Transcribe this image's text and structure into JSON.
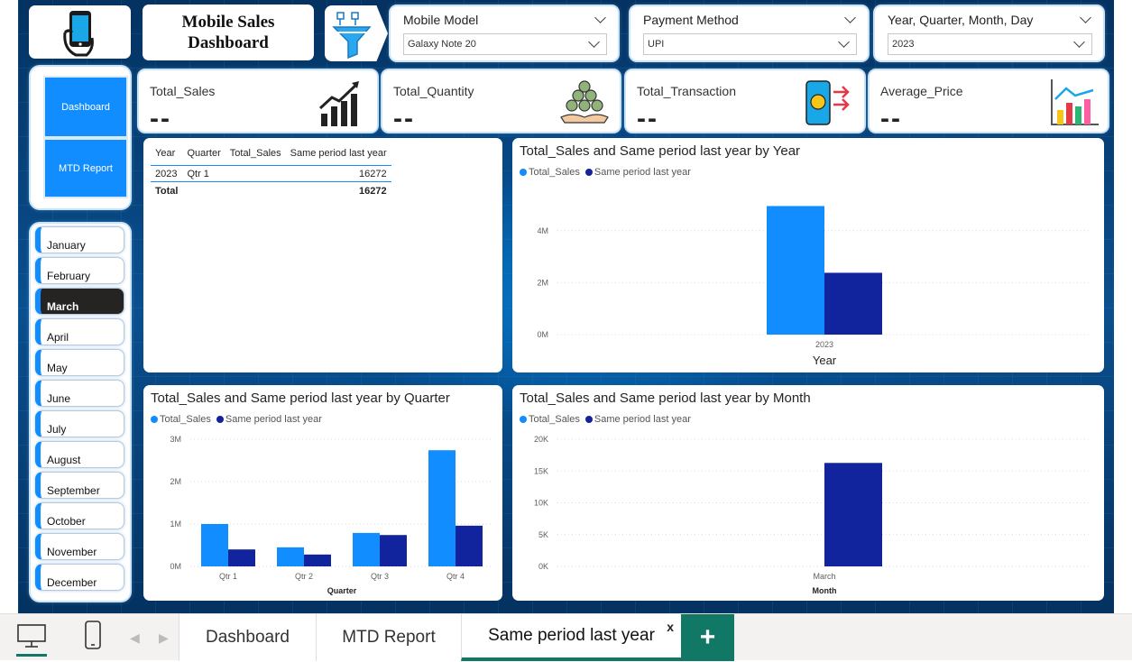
{
  "header": {
    "title_line1": "Mobile Sales",
    "title_line2": "Dashboard"
  },
  "slicers": {
    "mobile_model": {
      "label": "Mobile Model",
      "value": "Galaxy Note 20"
    },
    "payment_method": {
      "label": "Payment Method",
      "value": "UPI"
    },
    "date": {
      "label": "Year, Quarter, Month, Day",
      "value": "2023"
    }
  },
  "kpis": [
    {
      "label": "Total_Sales",
      "value": "--",
      "icon": "trend-chart-icon"
    },
    {
      "label": "Total_Quantity",
      "value": "--",
      "icon": "money-stack-icon"
    },
    {
      "label": "Total_Transaction",
      "value": "--",
      "icon": "phone-payment-icon"
    },
    {
      "label": "Average_Price",
      "value": "--",
      "icon": "bar-line-chart-icon"
    }
  ],
  "nav": {
    "dashboard": "Dashboard",
    "mtd_report": "MTD Report"
  },
  "months": [
    "January",
    "February",
    "March",
    "April",
    "May",
    "June",
    "July",
    "August",
    "September",
    "October",
    "November",
    "December"
  ],
  "active_month": "March",
  "matrix": {
    "headers": [
      "Year",
      "Quarter",
      "Total_Sales",
      "Same period last year"
    ],
    "row": {
      "year": "2023",
      "quarter": "Qtr 1",
      "total_sales": "",
      "same_period": "16272"
    },
    "total": {
      "label": "Total",
      "same_period": "16272"
    }
  },
  "legend": {
    "s1": "Total_Sales",
    "s2": "Same period last year"
  },
  "colors": {
    "total_sales": "#118dff",
    "same_period": "#12239e",
    "accent_green": "#117865"
  },
  "chart_data": [
    {
      "type": "bar",
      "title": "Total_Sales and Same period last year by Year",
      "xlabel": "Year",
      "ylabel": "",
      "categories": [
        "2023"
      ],
      "series": [
        {
          "name": "Total_Sales",
          "values": [
            4950000
          ]
        },
        {
          "name": "Same period last year",
          "values": [
            2380000
          ]
        }
      ],
      "ylim": [
        0,
        5000000
      ],
      "yticks": [
        "0M",
        "2M",
        "4M"
      ],
      "ytick_values": [
        0,
        2000000,
        4000000
      ]
    },
    {
      "type": "bar",
      "title": "Total_Sales and Same period last year by Quarter",
      "xlabel": "Quarter",
      "ylabel": "",
      "categories": [
        "Qtr 1",
        "Qtr 2",
        "Qtr 3",
        "Qtr 4"
      ],
      "series": [
        {
          "name": "Total_Sales",
          "values": [
            1000000,
            450000,
            790000,
            2740000
          ]
        },
        {
          "name": "Same period last year",
          "values": [
            400000,
            280000,
            740000,
            960000
          ]
        }
      ],
      "ylim": [
        0,
        3000000
      ],
      "yticks": [
        "0M",
        "1M",
        "2M",
        "3M"
      ],
      "ytick_values": [
        0,
        1000000,
        2000000,
        3000000
      ]
    },
    {
      "type": "bar",
      "title": "Total_Sales and Same period last year by Month",
      "xlabel": "Month",
      "ylabel": "",
      "categories": [
        "March"
      ],
      "series": [
        {
          "name": "Total_Sales",
          "values": [
            0
          ]
        },
        {
          "name": "Same period last year",
          "values": [
            16272
          ]
        }
      ],
      "ylim": [
        0,
        20000
      ],
      "yticks": [
        "0K",
        "5K",
        "10K",
        "15K",
        "20K"
      ],
      "ytick_values": [
        0,
        5000,
        10000,
        15000,
        20000
      ]
    }
  ],
  "tabs": [
    {
      "label": "Dashboard"
    },
    {
      "label": "MTD Report"
    },
    {
      "label": "Same period last year"
    }
  ],
  "tab_close": "x",
  "tab_add": "+"
}
